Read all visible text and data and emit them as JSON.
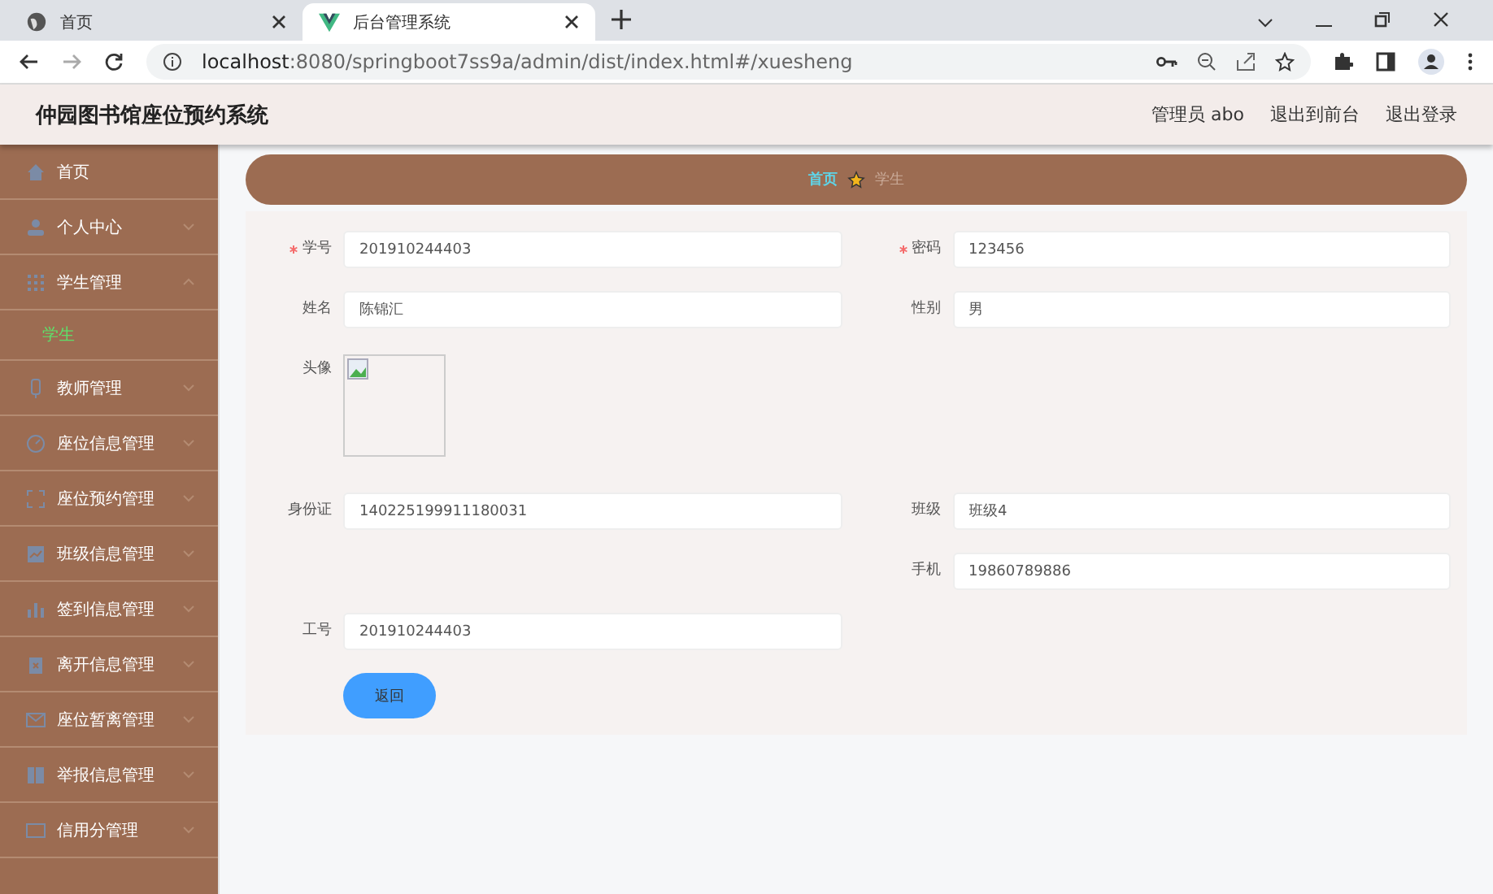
{
  "browser": {
    "tabs": [
      {
        "title": "首页",
        "selected": false
      },
      {
        "title": "后台管理系统",
        "selected": true
      }
    ],
    "url_host": "localhost",
    "url_rest": ":8080/springboot7ss9a/admin/dist/index.html#/xuesheng"
  },
  "header": {
    "title": "仲园图书馆座位预约系统",
    "links": [
      "管理员 abo",
      "退出到前台",
      "退出登录"
    ]
  },
  "sidebar": {
    "items": [
      {
        "label": "首页"
      },
      {
        "label": "个人中心",
        "expanded": false
      },
      {
        "label": "学生管理",
        "expanded": true,
        "children": [
          {
            "label": "学生",
            "selected": true
          }
        ]
      },
      {
        "label": "教师管理",
        "expanded": false
      },
      {
        "label": "座位信息管理",
        "expanded": false
      },
      {
        "label": "座位预约管理",
        "expanded": false
      },
      {
        "label": "班级信息管理",
        "expanded": false
      },
      {
        "label": "签到信息管理",
        "expanded": false
      },
      {
        "label": "离开信息管理",
        "expanded": false
      },
      {
        "label": "座位暂离管理",
        "expanded": false
      },
      {
        "label": "举报信息管理",
        "expanded": false
      },
      {
        "label": "信用分管理",
        "expanded": false
      }
    ]
  },
  "breadcrumb": [
    "首页",
    "学生"
  ],
  "form": {
    "rows": [
      {
        "left": {
          "label": "学号",
          "required": true,
          "kind": "text",
          "value": "201910244403"
        },
        "right": {
          "label": "密码",
          "required": true,
          "kind": "text",
          "value": "123456"
        }
      },
      {
        "left": {
          "label": "姓名",
          "required": false,
          "kind": "text",
          "value": "陈锦汇"
        },
        "right": {
          "label": "性别",
          "required": false,
          "kind": "text",
          "value": "男"
        }
      },
      {
        "left": {
          "label": "头像",
          "required": false,
          "kind": "image"
        }
      },
      {
        "left": {
          "label": "身份证",
          "required": false,
          "kind": "text",
          "value": "140225199911180031"
        },
        "right": {
          "label": "班级",
          "required": false,
          "kind": "text",
          "value": "班级4"
        }
      },
      {
        "right": {
          "label": "手机",
          "required": false,
          "kind": "text",
          "value": "19860789886"
        }
      },
      {
        "left": {
          "label": "工号",
          "required": false,
          "kind": "text",
          "value": "201910244403"
        }
      }
    ],
    "button": "返回"
  }
}
